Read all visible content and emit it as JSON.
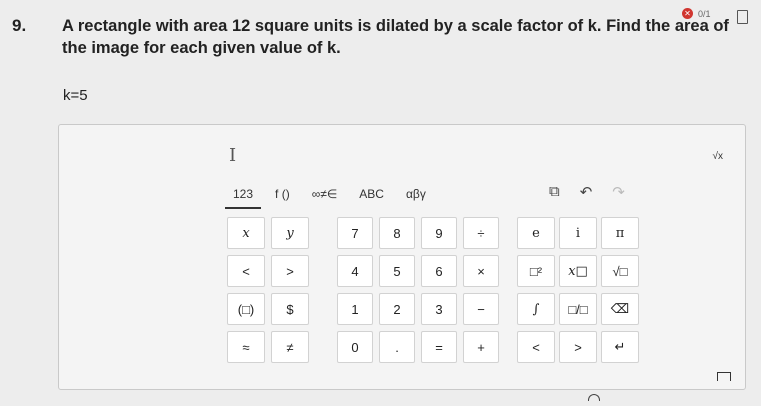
{
  "question": {
    "number": "9.",
    "text": "A rectangle with area 12 square units is dilated by a scale factor of k. Find the area of the image for each given value of k.",
    "given": "k=5"
  },
  "status": {
    "icon": "x-icon",
    "score": "0/1"
  },
  "answer": {
    "cursor": "I",
    "help_symbol": "√x"
  },
  "tabs": [
    {
      "label": "123"
    },
    {
      "label": "f ()"
    },
    {
      "label": "∞≠∈"
    },
    {
      "label": "ABC"
    },
    {
      "label": "αβγ"
    }
  ],
  "tools": {
    "copy": "⧉",
    "undo": "↶",
    "redo": "↷"
  },
  "keys": {
    "r1": [
      "x",
      "y",
      "7",
      "8",
      "9",
      "÷",
      "e",
      "i",
      "π"
    ],
    "r2": [
      "<",
      ">",
      "4",
      "5",
      "6",
      "×",
      "□²",
      "x□",
      "√□"
    ],
    "r3": [
      "(□)",
      "$",
      "1",
      "2",
      "3",
      "−",
      "∫",
      "□/□",
      "⌫"
    ],
    "r4": [
      "≈",
      "≠",
      "0",
      ".",
      "=",
      "+",
      "<",
      ">",
      "↵"
    ]
  }
}
